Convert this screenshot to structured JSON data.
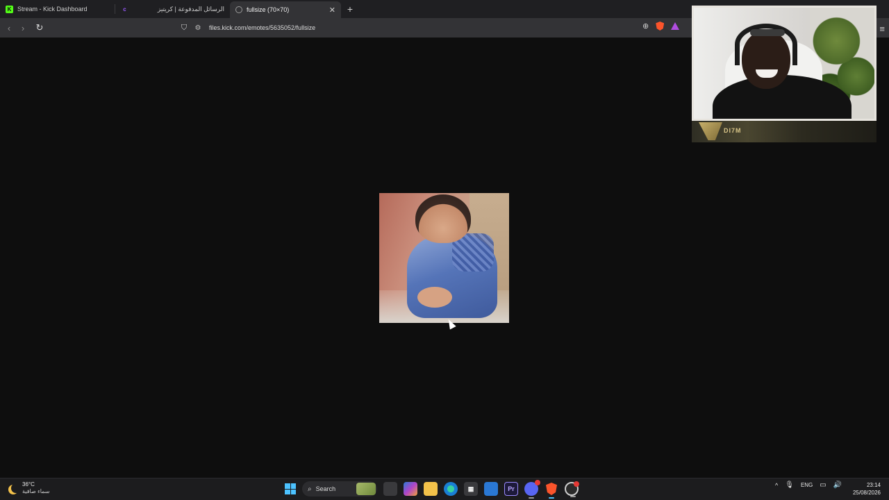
{
  "browser": {
    "tabs": [
      {
        "label": "Stream - Kick Dashboard",
        "favicon": "K"
      },
      {
        "label": "الرسائل المدفوعة | كريتيز",
        "favicon": "c"
      },
      {
        "label": "fullsize (70×70)",
        "favicon": ""
      }
    ],
    "new_tab": "+",
    "url": "files.kick.com/emotes/5635052/fullsize",
    "icons": {
      "back": "back-arrow-icon",
      "forward": "forward-arrow-icon",
      "reload": "reload-icon",
      "bookmark": "bookmark-icon",
      "site_settings": "site-settings-icon",
      "zoom": "zoom-icon",
      "brave_shields": "brave-shields-icon",
      "rewards": "brave-rewards-icon",
      "menu": "hamburger-menu-icon"
    },
    "colors": {
      "brand_kick": "#53fc18",
      "brave": "#fb542b"
    }
  },
  "emote": {
    "alt": "fullsize emote image"
  },
  "webcam": {
    "tag": "DI7M"
  },
  "taskbar": {
    "weather": {
      "temp": "36°C",
      "condition": "سماء صافية"
    },
    "search_label": "Search",
    "apps": [
      "task-view",
      "microsoft-365",
      "file-explorer",
      "edge",
      "store",
      "mail",
      "premiere-pro",
      "discord",
      "brave",
      "obs"
    ],
    "tray": {
      "chevron": "^",
      "language": "ENG"
    },
    "clock": {
      "time": "23:14",
      "date": "25/08/2026"
    }
  }
}
